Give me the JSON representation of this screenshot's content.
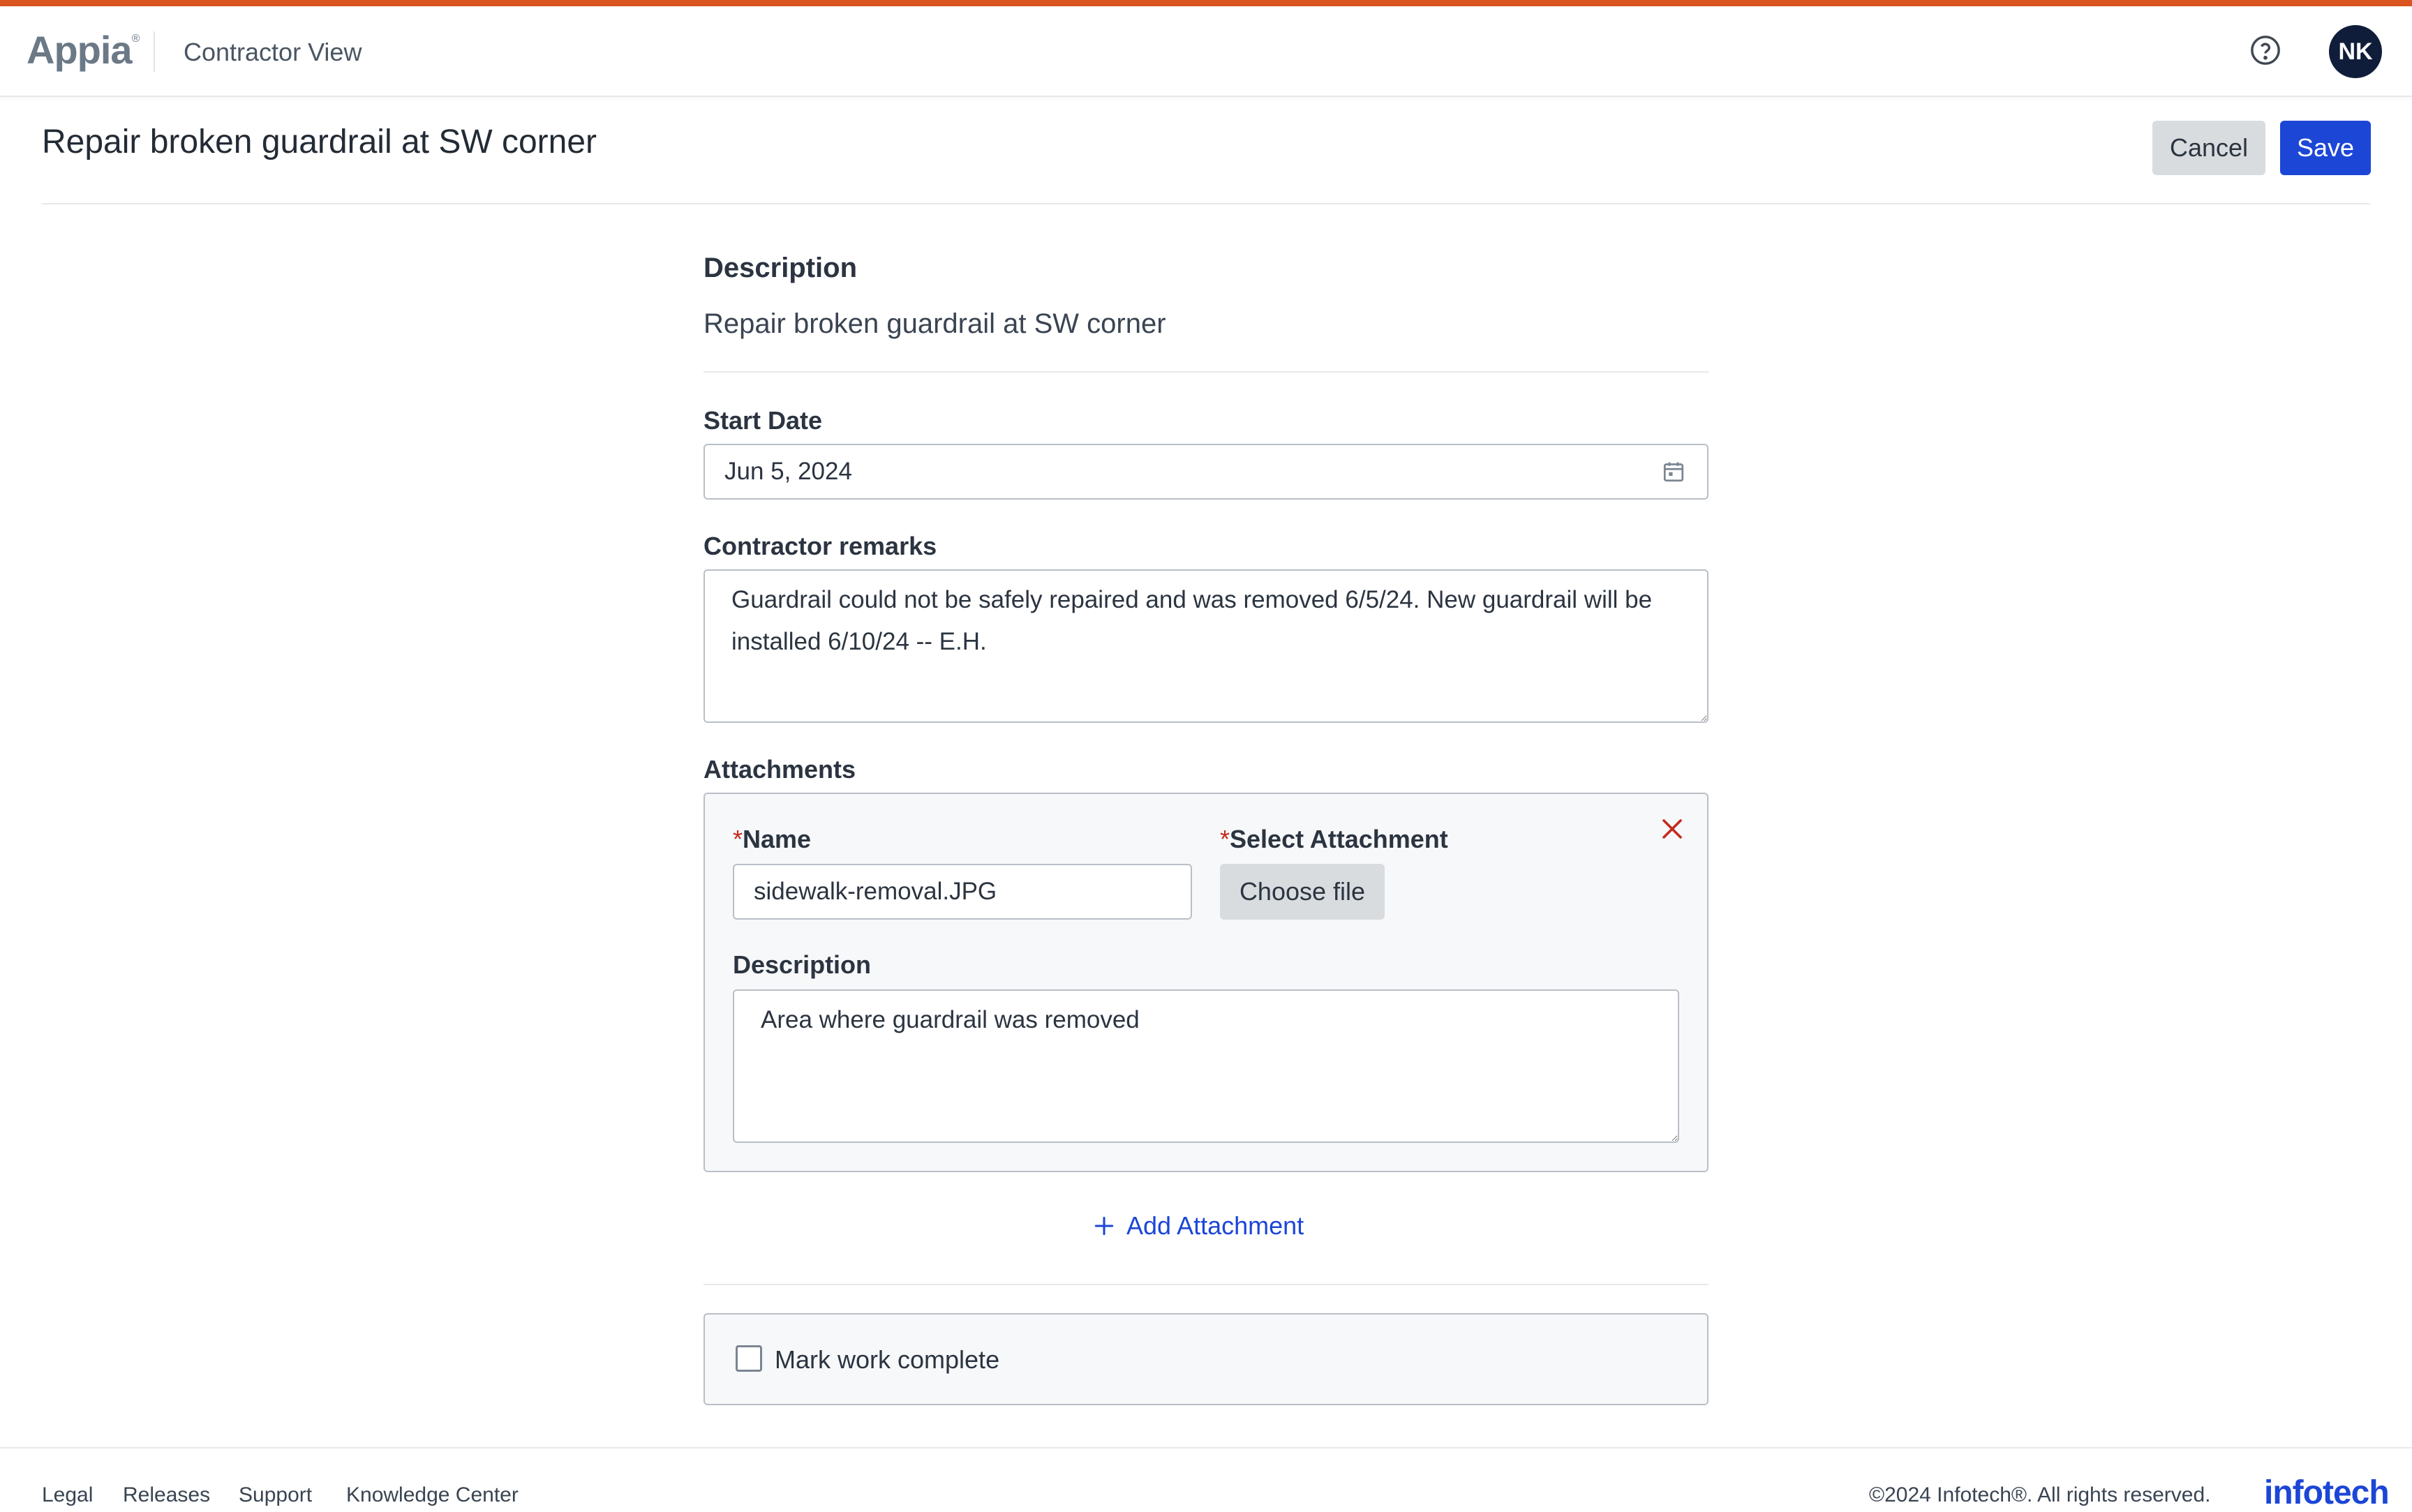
{
  "header": {
    "logo": "Appia",
    "logo_mark": "®",
    "view_title": "Contractor View",
    "help_icon": "help-circle-icon",
    "user_initials": "NK"
  },
  "page": {
    "title": "Repair broken guardrail at SW corner",
    "cancel_label": "Cancel",
    "save_label": "Save"
  },
  "form": {
    "description_label": "Description",
    "description_text": "Repair broken guardrail at SW corner",
    "start_date_label": "Start Date",
    "start_date_value": "Jun 5, 2024",
    "remarks_label": "Contractor remarks",
    "remarks_value": "Guardrail could not be safely repaired and was removed 6/5/24. New guardrail will be installed 6/10/24 -- E.H.",
    "attachments_label": "Attachments",
    "attachment": {
      "required_mark": "*",
      "name_label": "Name",
      "name_value": "sidewalk-removal.JPG",
      "select_label": "Select Attachment",
      "choose_file_label": "Choose file",
      "description_label": "Description",
      "description_value": "Area where guardrail was removed"
    },
    "add_attachment_label": "Add Attachment",
    "mark_complete_label": "Mark work complete",
    "mark_complete_checked": false
  },
  "footer": {
    "links": [
      "Legal",
      "Releases",
      "Support",
      "Knowledge Center"
    ],
    "copyright": "©2024 Infotech®. All rights reserved.",
    "logo": "infotech"
  },
  "colors": {
    "accent_bar": "#d9541e",
    "primary": "#1c46d6",
    "danger": "#c42a1e",
    "avatar_bg": "#101d3a"
  }
}
